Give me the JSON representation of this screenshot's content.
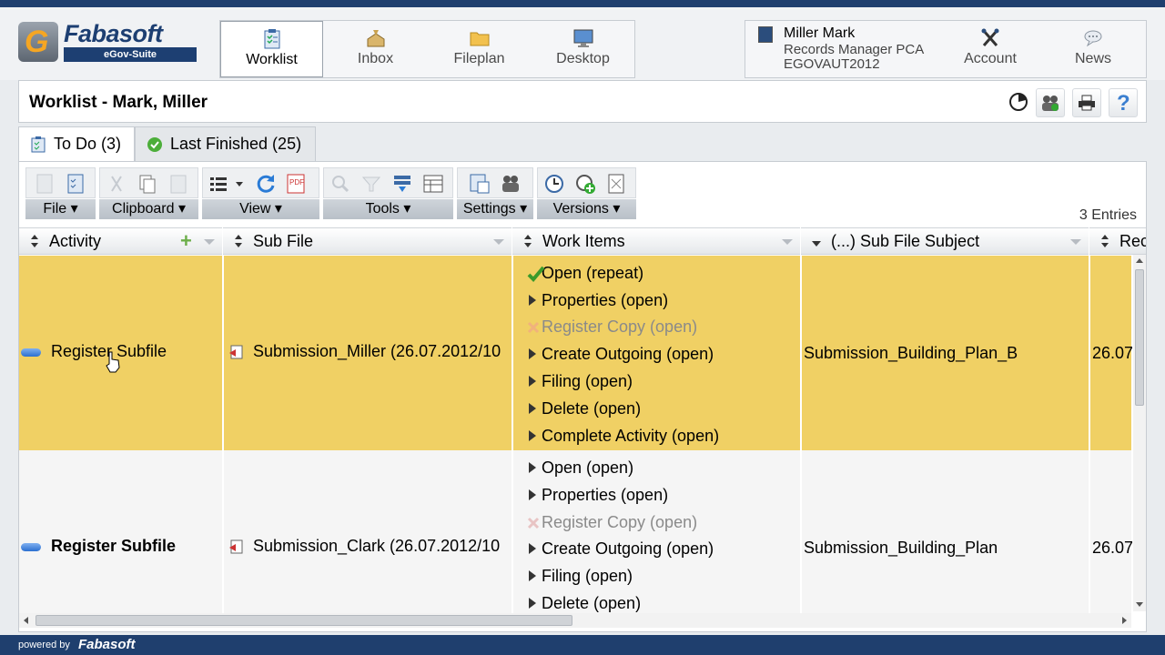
{
  "logo": {
    "name": "Fabasoft",
    "sub": "eGov-Suite"
  },
  "nav": [
    {
      "label": "Worklist",
      "icon": "worklist-icon",
      "active": true
    },
    {
      "label": "Inbox",
      "icon": "inbox-icon"
    },
    {
      "label": "Fileplan",
      "icon": "folder-icon"
    },
    {
      "label": "Desktop",
      "icon": "desktop-icon"
    }
  ],
  "user": {
    "name": "Miller Mark",
    "role": "Records Manager PCA",
    "org": "EGOVAUT2012"
  },
  "account_label": "Account",
  "news_label": "News",
  "page_title": "Worklist - Mark, Miller",
  "tabs": {
    "todo": "To Do (3)",
    "finished": "Last Finished (25)"
  },
  "toolbar": {
    "file": "File",
    "clipboard": "Clipboard",
    "view": "View",
    "tools": "Tools",
    "settings": "Settings",
    "versions": "Versions"
  },
  "entries": "3 Entries",
  "columns": {
    "activity": "Activity",
    "subfile": "Sub File",
    "workitems": "Work Items",
    "subject": "(...) Sub File Subject",
    "received": "Rec"
  },
  "rows": [
    {
      "activity": "Register Subfile",
      "subfile": "Submission_Miller (26.07.2012/10",
      "subject": "Submission_Building_Plan_B",
      "date": "26.07",
      "workitems": [
        "Open (repeat)",
        "Properties (open)",
        "Register Copy (open)",
        "Create Outgoing (open)",
        "Filing (open)",
        "Delete (open)",
        "Complete Activity (open)"
      ]
    },
    {
      "activity": "Register Subfile",
      "subfile": "Submission_Clark (26.07.2012/10",
      "subject": "Submission_Building_Plan",
      "date": "26.07",
      "workitems": [
        "Open (open)",
        "Properties (open)",
        "Register Copy (open)",
        "Create Outgoing (open)",
        "Filing (open)",
        "Delete (open)"
      ]
    }
  ],
  "footer": {
    "powered": "powered by",
    "brand": "Fabasoft"
  }
}
